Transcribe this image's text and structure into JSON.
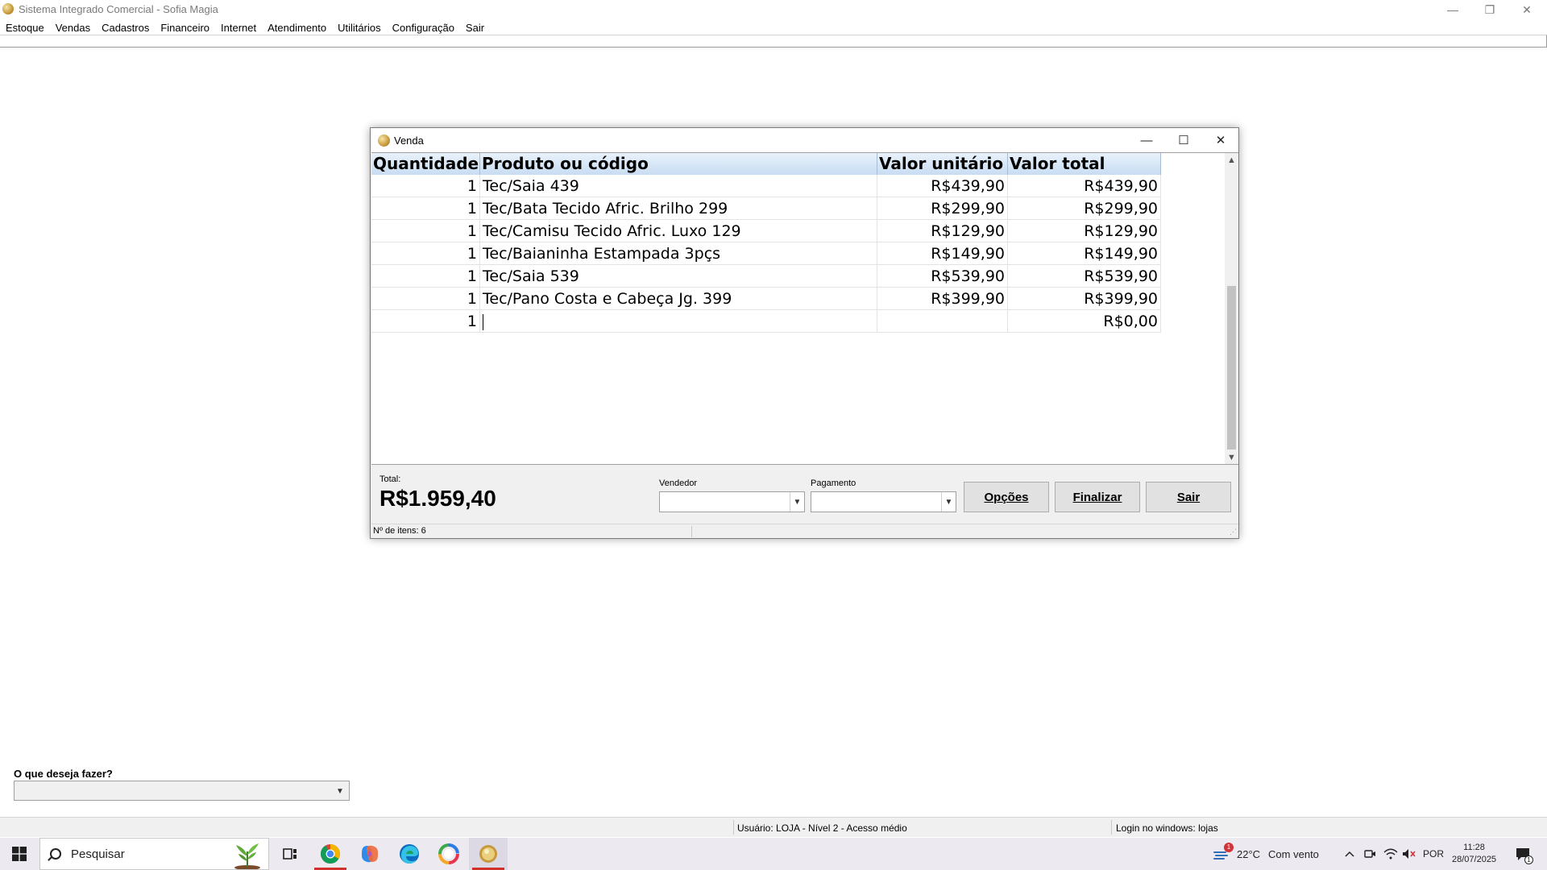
{
  "main_window": {
    "title": "Sistema Integrado Comercial - Sofia Magia",
    "controls": {
      "minimize": "—",
      "restore": "❐",
      "close": "✕"
    }
  },
  "menu": [
    "Estoque",
    "Vendas",
    "Cadastros",
    "Financeiro",
    "Internet",
    "Atendimento",
    "Utilitários",
    "Configuração",
    "Sair"
  ],
  "venda": {
    "title": "Venda",
    "controls": {
      "minimize": "—",
      "maximize": "☐",
      "close": "✕"
    },
    "columns": [
      "Quantidade",
      "Produto ou código",
      "Valor unitário",
      "Valor total"
    ],
    "rows": [
      {
        "qty": "1",
        "product": "Tec/Saia 439",
        "unit": "R$439,90",
        "total": "R$439,90"
      },
      {
        "qty": "1",
        "product": "Tec/Bata Tecido Afric. Brilho 299",
        "unit": "R$299,90",
        "total": "R$299,90"
      },
      {
        "qty": "1",
        "product": "Tec/Camisu Tecido Afric. Luxo 129",
        "unit": "R$129,90",
        "total": "R$129,90"
      },
      {
        "qty": "1",
        "product": "Tec/Baianinha Estampada 3pçs",
        "unit": "R$149,90",
        "total": "R$149,90"
      },
      {
        "qty": "1",
        "product": "Tec/Saia 539",
        "unit": "R$539,90",
        "total": "R$539,90"
      },
      {
        "qty": "1",
        "product": "Tec/Pano Costa e Cabeça Jg. 399",
        "unit": "R$399,90",
        "total": "R$399,90"
      }
    ],
    "new_row": {
      "qty": "1",
      "product": "",
      "unit": "",
      "total": "R$0,00"
    },
    "total_label": "Total:",
    "total_value": "R$1.959,40",
    "vendedor_label": "Vendedor",
    "vendedor_value": "",
    "pagamento_label": "Pagamento",
    "pagamento_value": "",
    "buttons": {
      "opcoes": "Opções",
      "finalizar": "Finalizar",
      "sair": "Sair"
    },
    "status_items": "Nº de itens: 6"
  },
  "bottom": {
    "what_label": "O que deseja fazer?",
    "what_value": ""
  },
  "app_status": {
    "user": "Usuário: LOJA - Nível 2 - Acesso médio",
    "login": "Login no windows: lojas"
  },
  "taskbar": {
    "search_placeholder": "Pesquisar",
    "weather_temp": "22°C",
    "weather_desc": "Com vento",
    "weather_badge": "1",
    "language": "POR",
    "time": "11:28",
    "date": "28/07/2025",
    "notification_count": "1",
    "icons": [
      "windows-start-icon",
      "task-view-icon",
      "chrome-icon",
      "copilot-icon",
      "edge-icon",
      "photos-icon",
      "sofia-magia-app-icon"
    ]
  },
  "colors": {
    "grid_header_top": "#e9f2fb",
    "grid_header_bottom": "#c8dcf2",
    "taskbar_bg": "#ece9f0",
    "active_indicator": "#d0312d"
  }
}
